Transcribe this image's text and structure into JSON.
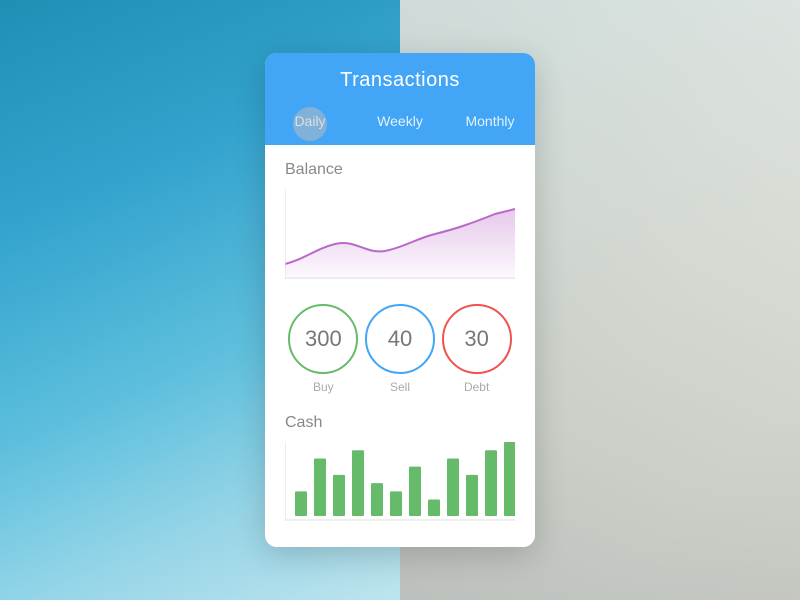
{
  "background": {
    "description": "blurred aerial beach photo"
  },
  "header": {
    "title": "Transactions",
    "accent_color": "#42a5f5"
  },
  "tabs": [
    {
      "label": "Daily",
      "active": true
    },
    {
      "label": "Weekly",
      "active": false
    },
    {
      "label": "Monthly",
      "active": false
    }
  ],
  "balance_section": {
    "title": "Balance",
    "chart_color": "#ce93d8",
    "chart_fill": "rgba(186,104,200,0.25)"
  },
  "stats": [
    {
      "value": "300",
      "label": "Buy",
      "color": "#66bb6a"
    },
    {
      "value": "40",
      "label": "Sell",
      "color": "#42a5f5"
    },
    {
      "value": "30",
      "label": "Debt",
      "color": "#ef5350"
    }
  ],
  "cash_section": {
    "title": "Cash",
    "bar_color": "#66bb6a"
  },
  "cash_bars": [
    3,
    7,
    5,
    8,
    4,
    3,
    6,
    2,
    7,
    5,
    8,
    9
  ]
}
